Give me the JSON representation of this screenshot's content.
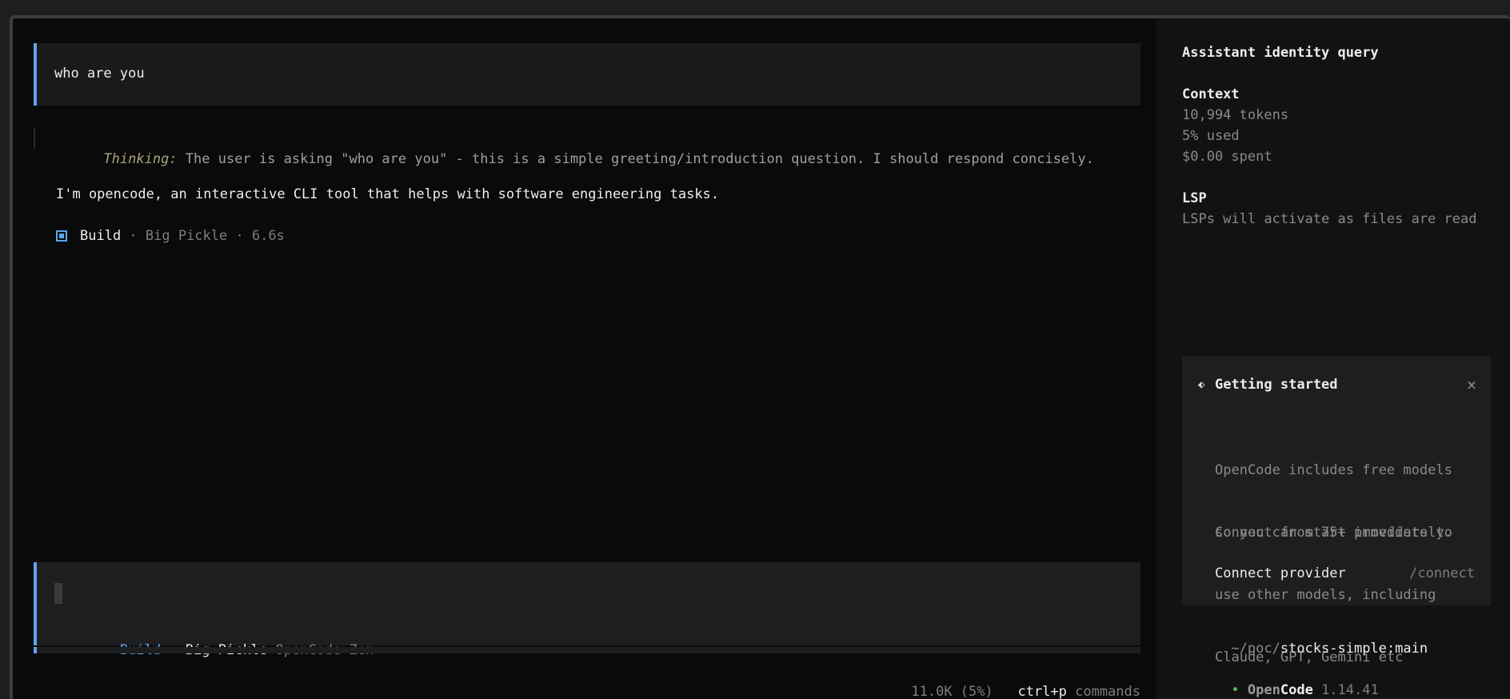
{
  "conversation": {
    "user_prompt": "who are you",
    "thinking_label": "Thinking:",
    "thinking_text": " The user is asking \"who are you\" - this is a simple greeting/introduction question. I should respond concisely.",
    "reply": "I'm opencode, an interactive CLI tool that helps with software engineering tasks.",
    "meta": {
      "agent": "Build",
      "details": " · Big Pickle · 6.6s"
    }
  },
  "input": {
    "agent": "Build",
    "separator": " · ",
    "model": "Big Pickle",
    "provider": " OpenCode Zen"
  },
  "footer": {
    "usage": "11.0K (5%)",
    "shortcut_key": "ctrl+p",
    "shortcut_label": " commands"
  },
  "sidebar": {
    "session_title": "Assistant identity query",
    "context": {
      "heading": "Context",
      "tokens": "10,994 tokens",
      "used": "5% used",
      "spent": "$0.00 spent"
    },
    "lsp": {
      "heading": "LSP",
      "message": "LSPs will activate as files are read"
    },
    "getting_started": {
      "icon": "⬖",
      "title": "Getting started",
      "close": "×",
      "para1_line1": "OpenCode includes free models",
      "para1_line2": "so you can start immediately.",
      "para2_line1": "Connect from 75+ providers to",
      "para2_line2": "use other models, including",
      "para2_line3": "Claude, GPT, Gemini etc",
      "connect_label": "Connect provider",
      "connect_shortcut": "/connect"
    },
    "path": {
      "prefix": "~/poc/",
      "repo": "stocks-simple:main"
    },
    "version": {
      "dot": "•",
      "brand_open": "Open",
      "brand_code": "Code",
      "number": " 1.14.41"
    }
  },
  "colors": {
    "accent": "#5ba6f0",
    "status_green": "#4fbf67",
    "thinking": "#a9a378"
  }
}
